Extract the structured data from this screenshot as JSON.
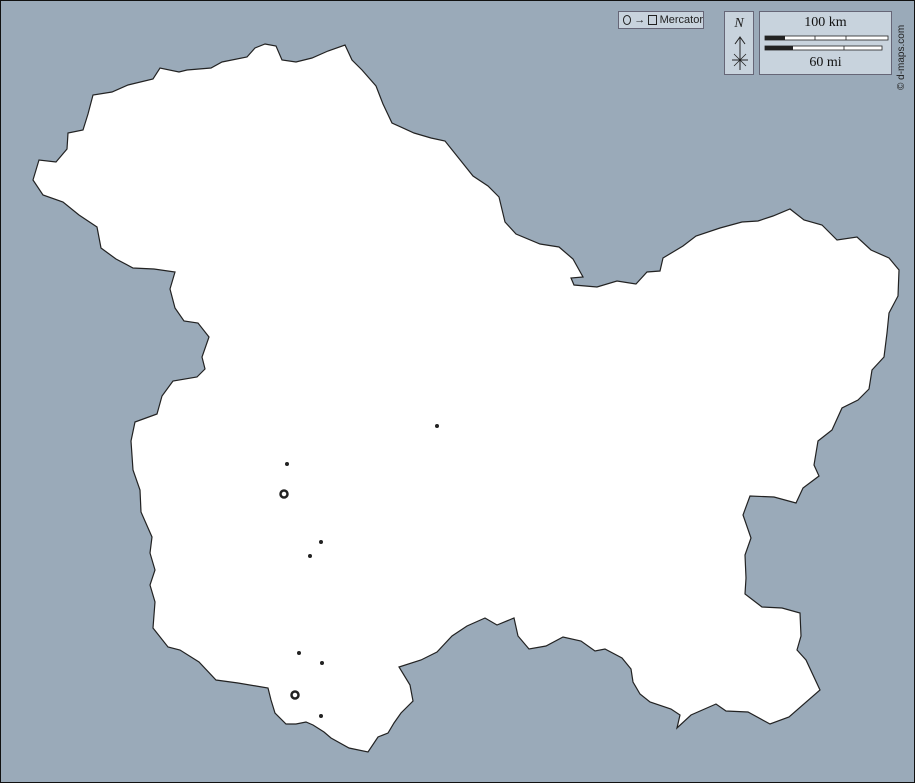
{
  "map": {
    "ocean_color": "#9aaab9",
    "land_color": "#ffffff",
    "border_color": "#222222"
  },
  "projection": {
    "label": "Mercator",
    "icon_from": "circle-icon",
    "icon_arrow": "→",
    "icon_to": "square-icon"
  },
  "north_arrow": {
    "label": "N"
  },
  "scale_bar": {
    "km_label": "100 km",
    "mi_label": "60 mi"
  },
  "credit": "© d-maps.com"
}
